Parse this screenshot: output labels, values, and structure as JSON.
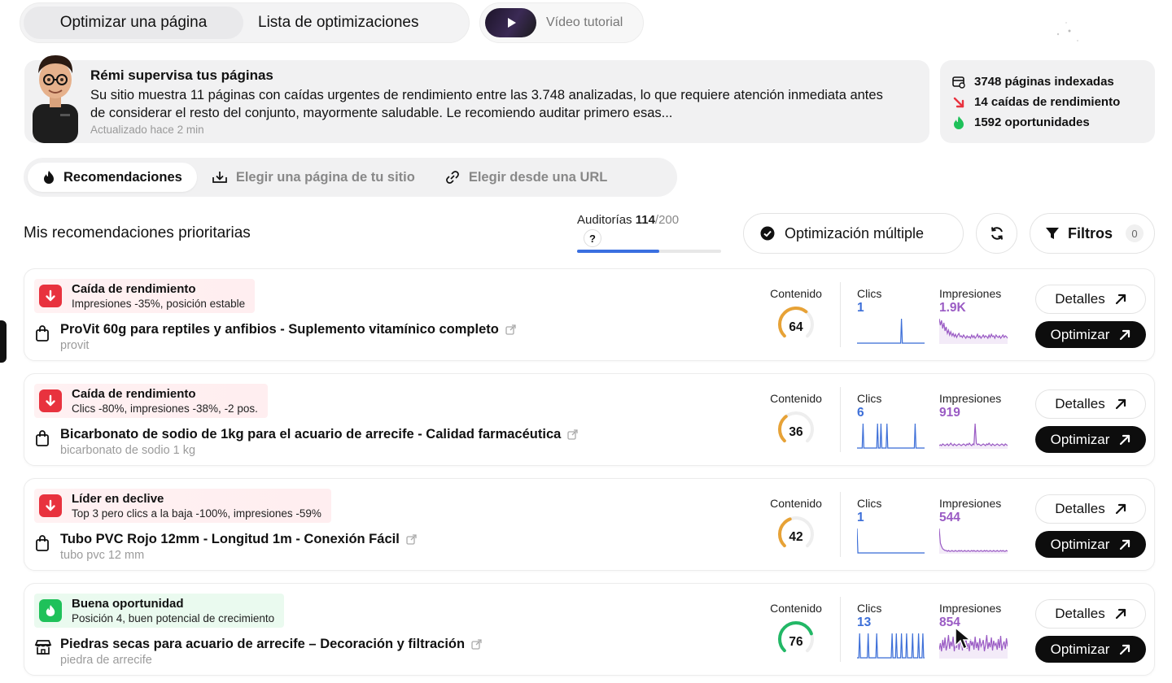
{
  "top_tabs": {
    "optimize": "Optimizar una página",
    "list": "Lista de optimizaciones"
  },
  "video": {
    "label": "Vídeo tutorial"
  },
  "remi": {
    "title": "Rémi supervisa tus páginas",
    "text": "Su sitio muestra 11 páginas con caídas urgentes de rendimiento entre las 3.748 analizadas, lo que requiere atención inmediata antes de considerar el resto del conjunto, mayormente saludable. Le recomiendo auditar primero esas...",
    "updated": "Actualizado hace 2 min"
  },
  "stats": {
    "indexed": "3748 páginas indexadas",
    "drops": "14 caídas de rendimiento",
    "opportunities": "1592 oportunidades"
  },
  "source_tabs": {
    "recommendations": "Recomendaciones",
    "choose_page": "Elegir una página de tu sitio",
    "choose_url": "Elegir desde una URL"
  },
  "header": {
    "title": "Mis recomendaciones prioritarias",
    "audits_label": "Auditorías",
    "audits_used": "114",
    "audits_total": "/200",
    "audits_fraction": 0.57,
    "help": "?",
    "multi_button": "Optimización múltiple",
    "filters_button": "Filtros",
    "filters_count": "0"
  },
  "columns": {
    "content": "Contenido",
    "clicks": "Clics",
    "impressions": "Impresiones"
  },
  "buttons": {
    "details": "Detalles",
    "optimize": "Optimizar"
  },
  "colors": {
    "drop": "#e8323e",
    "opportunity": "#1fc15a",
    "clicks": "#3d6fd8",
    "impressions": "#9a5bc4",
    "gauge_orange": "#e7a236",
    "gauge_green": "#22b866"
  },
  "cards": [
    {
      "tag_type": "drop",
      "tag_title": "Caída de rendimiento",
      "tag_sub": "Impresiones -35%, posición estable",
      "page_icon": "shopping-bag-icon",
      "page_title": "ProVit 60g para reptiles y anfibios - Suplemento vitamínico completo",
      "keyword": "provit",
      "content_score": "64",
      "clicks": "1",
      "impressions": "1.9K",
      "clicks_series": [
        0,
        0,
        0,
        0,
        0,
        0,
        0,
        0,
        0,
        0,
        0,
        0,
        0,
        0,
        0,
        0,
        0,
        0,
        0,
        0,
        0,
        0,
        0,
        0,
        0,
        0,
        0,
        0,
        0,
        0,
        0,
        0,
        0,
        0,
        0,
        0,
        0,
        0,
        0,
        0,
        0,
        0,
        0,
        0,
        0,
        0,
        0,
        0,
        0,
        0,
        0,
        0,
        1,
        0,
        0,
        0,
        0,
        0,
        0,
        0,
        0,
        0,
        0,
        0,
        0,
        0,
        0,
        0,
        0,
        0,
        0,
        0,
        0,
        0,
        0,
        0,
        0,
        0,
        0,
        0
      ],
      "impressions_series": [
        30,
        22,
        28,
        18,
        25,
        15,
        20,
        12,
        16,
        10,
        14,
        9,
        12,
        8,
        11,
        7,
        10,
        12,
        8,
        9,
        7,
        10,
        8,
        6,
        9,
        7,
        8,
        6,
        10,
        7,
        9,
        6,
        8,
        11,
        7,
        9,
        6,
        8,
        10,
        7,
        9,
        8,
        6,
        10,
        7,
        11,
        8,
        9,
        6,
        10,
        8,
        7,
        9,
        6,
        8,
        10,
        7,
        9,
        8,
        6
      ]
    },
    {
      "tag_type": "drop",
      "tag_title": "Caída de rendimiento",
      "tag_sub": "Clics -80%, impresiones -38%, -2 pos.",
      "page_icon": "shopping-bag-icon",
      "page_title": "Bicarbonato de sodio de 1kg para el acuario de arrecife - Calidad farmacéutica",
      "keyword": "bicarbonato de sodio 1 kg",
      "content_score": "36",
      "clicks": "6",
      "impressions": "919",
      "clicks_series": [
        0,
        0,
        0,
        0,
        0,
        0,
        0,
        1,
        0,
        0,
        0,
        0,
        0,
        0,
        0,
        0,
        0,
        0,
        0,
        0,
        0,
        0,
        0,
        0,
        1,
        0,
        0,
        0,
        1,
        0,
        0,
        0,
        0,
        0,
        0,
        1,
        0,
        0,
        0,
        0,
        0,
        0,
        0,
        0,
        0,
        0,
        0,
        0,
        0,
        0,
        0,
        0,
        0,
        0,
        0,
        0,
        0,
        0,
        0,
        0,
        0,
        0,
        0,
        0,
        0,
        0,
        0,
        0,
        1,
        0,
        0,
        0,
        0,
        0,
        0,
        0,
        0,
        0,
        0,
        0
      ],
      "impressions_series": [
        3,
        4,
        3,
        5,
        4,
        3,
        4,
        5,
        3,
        4,
        6,
        4,
        3,
        5,
        4,
        3,
        4,
        5,
        4,
        3,
        4,
        5,
        4,
        3,
        5,
        4,
        6,
        4,
        3,
        5,
        4,
        30,
        6,
        4,
        5,
        4,
        3,
        4,
        5,
        4,
        3,
        5,
        4,
        6,
        4,
        3,
        5,
        4,
        3,
        4,
        5,
        4,
        3,
        4,
        5,
        4,
        3,
        5,
        4,
        3
      ]
    },
    {
      "tag_type": "drop",
      "tag_title": "Líder en declive",
      "tag_sub": "Top 3 pero clics a la baja -100%, impresiones -59%",
      "page_icon": "shopping-bag-icon",
      "page_title": "Tubo PVC Rojo 12mm - Longitud 1m - Conexión Fácil",
      "keyword": "tubo pvc 12 mm",
      "content_score": "42",
      "clicks": "1",
      "impressions": "544",
      "clicks_series": [
        1,
        0,
        0,
        0,
        0,
        0,
        0,
        0,
        0,
        0,
        0,
        0,
        0,
        0,
        0,
        0,
        0,
        0,
        0,
        0,
        0,
        0,
        0,
        0,
        0,
        0,
        0,
        0,
        0,
        0,
        0,
        0,
        0,
        0,
        0,
        0,
        0,
        0,
        0,
        0,
        0,
        0,
        0,
        0,
        0,
        0,
        0,
        0,
        0,
        0,
        0,
        0,
        0,
        0,
        0,
        0,
        0,
        0,
        0,
        0,
        0,
        0,
        0,
        0,
        0,
        0,
        0,
        0,
        0,
        0,
        0,
        0,
        0,
        0,
        0,
        0,
        0,
        0,
        0,
        0
      ],
      "impressions_series": [
        30,
        12,
        8,
        5,
        4,
        3,
        3,
        2,
        3,
        2,
        2,
        3,
        2,
        2,
        3,
        2,
        2,
        3,
        2,
        3,
        2,
        2,
        3,
        2,
        2,
        3,
        2,
        2,
        3,
        2,
        3,
        2,
        2,
        3,
        2,
        2,
        3,
        2,
        2,
        3,
        2,
        3,
        2,
        2,
        3,
        2,
        2,
        3,
        2,
        2,
        3,
        2,
        2,
        3,
        2,
        3,
        2,
        2,
        3,
        2
      ]
    },
    {
      "tag_type": "opportunity",
      "tag_title": "Buena oportunidad",
      "tag_sub": "Posición 4, buen potencial de crecimiento",
      "page_icon": "store-icon",
      "page_title": "Piedras secas para acuario de arrecife – Decoración y filtración",
      "keyword": "piedra de arrecife",
      "content_score": "76",
      "clicks": "13",
      "impressions": "854",
      "clicks_series": [
        0,
        0,
        0,
        1,
        0,
        0,
        0,
        0,
        0,
        0,
        0,
        0,
        0,
        1,
        0,
        0,
        0,
        0,
        0,
        0,
        0,
        0,
        0,
        1,
        0,
        0,
        0,
        0,
        0,
        0,
        0,
        0,
        0,
        0,
        0,
        0,
        0,
        0,
        0,
        0,
        0,
        1,
        0,
        0,
        0,
        0,
        1,
        0,
        0,
        0,
        0,
        0,
        1,
        0,
        0,
        0,
        0,
        0,
        1,
        0,
        0,
        0,
        0,
        0,
        0,
        1,
        0,
        0,
        0,
        0,
        0,
        0,
        1,
        0,
        0,
        0,
        0,
        1,
        0,
        0
      ],
      "impressions_series": [
        10,
        18,
        8,
        22,
        12,
        25,
        9,
        16,
        28,
        11,
        20,
        14,
        26,
        8,
        19,
        12,
        30,
        10,
        17,
        24,
        9,
        21,
        13,
        27,
        11,
        18,
        8,
        23,
        15,
        20,
        10,
        26,
        12,
        19,
        9,
        24,
        14,
        17,
        22,
        8,
        16,
        28,
        11,
        19,
        13,
        25,
        9,
        21,
        15,
        18,
        10,
        23,
        12,
        27,
        9,
        16,
        20,
        11,
        24,
        14
      ]
    }
  ]
}
